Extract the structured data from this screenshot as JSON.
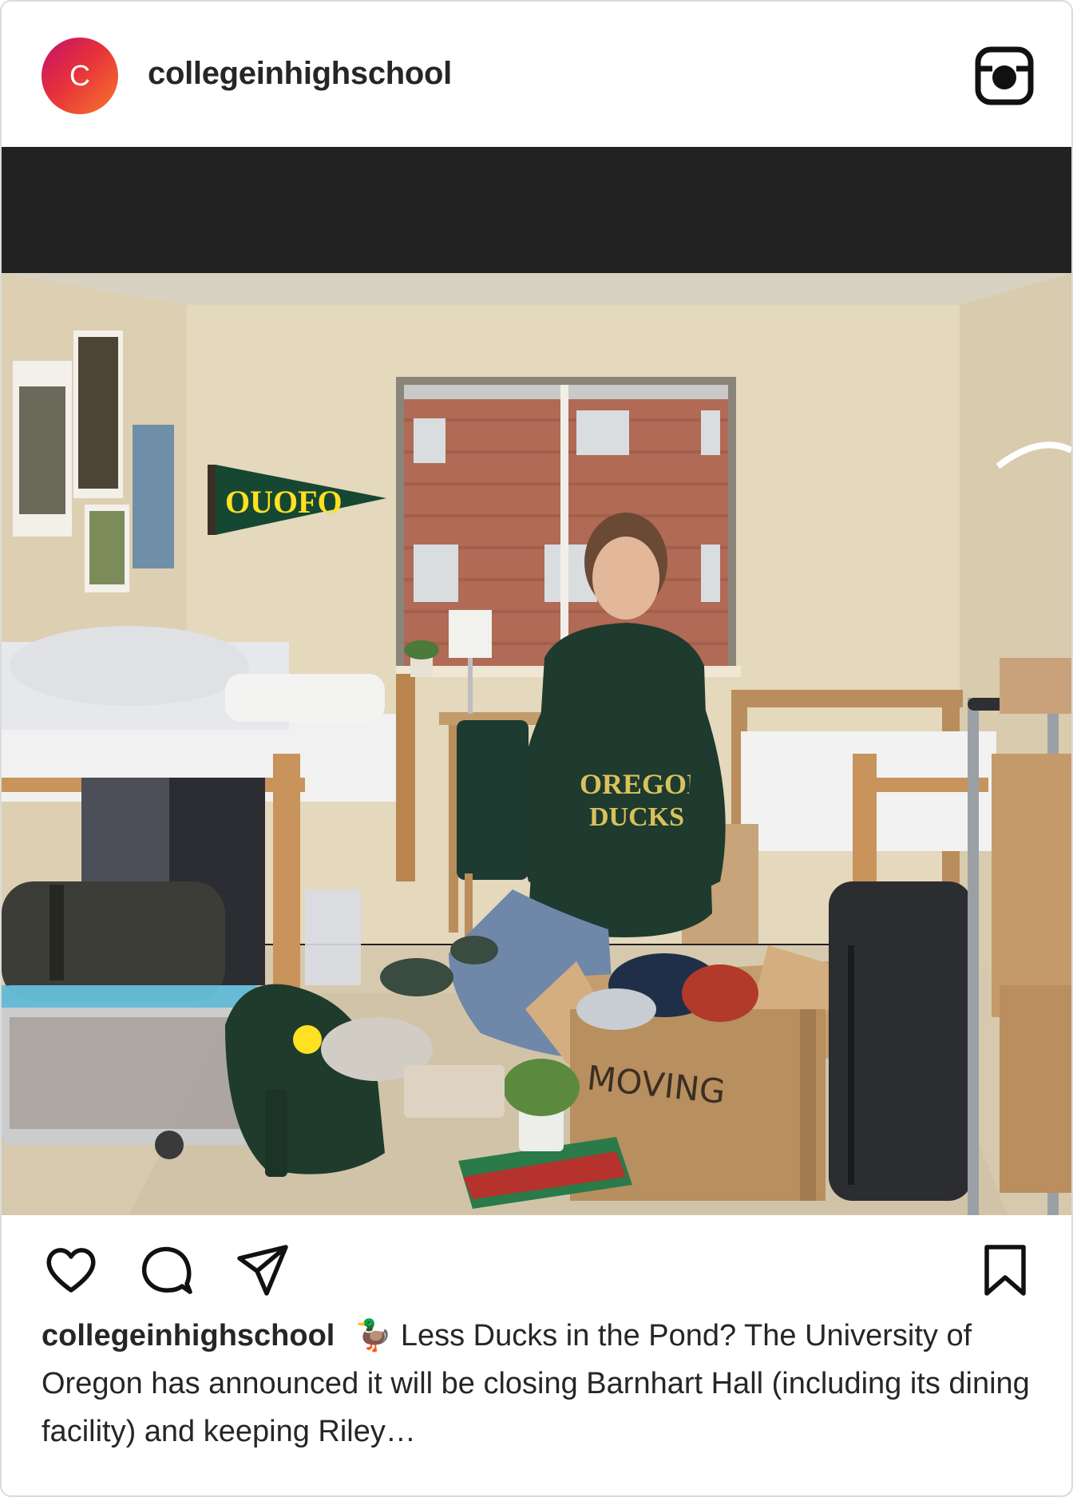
{
  "post": {
    "avatar_letter": "C",
    "username": "collegeinhighschool",
    "header_icon": "instagram-icon",
    "image": {
      "pennant_text": "OUOFO",
      "hoodie_line1": "OREGON",
      "hoodie_line2": "DUCKS",
      "box_text": "MOVING"
    },
    "actions": {
      "like_icon": "heart-icon",
      "comment_icon": "comment-bubble-icon",
      "share_icon": "paper-plane-icon",
      "save_icon": "bookmark-icon"
    },
    "caption": {
      "username": "collegeinhighschool",
      "emoji": "🦆",
      "text": "Less Ducks in the Pond? The University of Oregon has announced it will be closing Barnhart Hall (including its dining facility) and keeping Riley…"
    },
    "colors": {
      "avatar_gradient": [
        "#c1126c",
        "#e6303c",
        "#f7772b"
      ],
      "oregon_green": "#154733",
      "oregon_yellow": "#fee123"
    }
  }
}
